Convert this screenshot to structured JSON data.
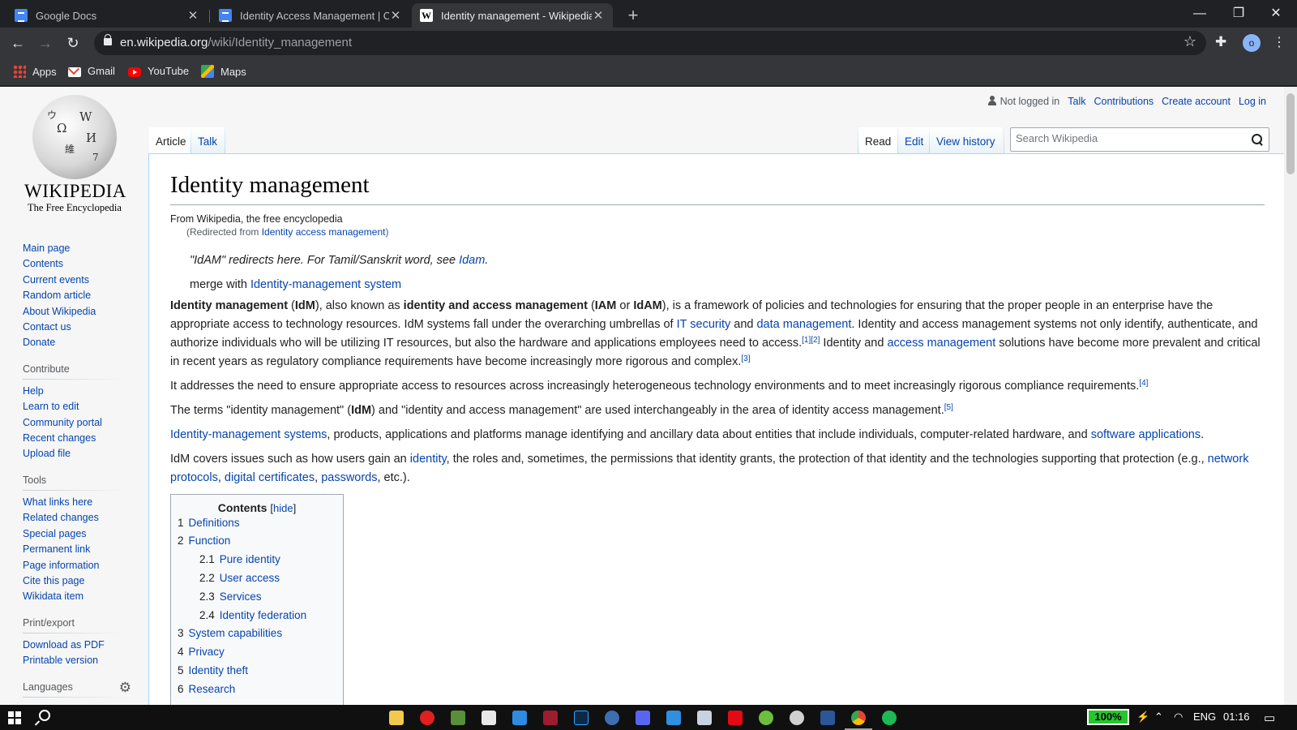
{
  "browser": {
    "tabs": [
      {
        "title": "Google Docs",
        "favicon": "docs-icon",
        "active": false
      },
      {
        "title": "Identity Access Management | Ch",
        "favicon": "docs-icon",
        "active": false
      },
      {
        "title": "Identity management - Wikipedia",
        "favicon": "wikipedia-icon",
        "active": true
      }
    ],
    "new_tab": "+",
    "url_host": "en.wikipedia.org",
    "url_path": "/wiki/Identity_management",
    "profile_initial": "o",
    "bookmarks": [
      {
        "label": "Apps",
        "icon": "apps-grid-icon"
      },
      {
        "label": "Gmail",
        "icon": "gmail-icon"
      },
      {
        "label": "YouTube",
        "icon": "youtube-icon"
      },
      {
        "label": "Maps",
        "icon": "maps-icon"
      }
    ]
  },
  "wiki": {
    "logo": {
      "wordmark": "WIKIPEDIA",
      "tagline": "The Free Encyclopedia"
    },
    "personal": {
      "not_logged_in": "Not logged in",
      "talk": "Talk",
      "contributions": "Contributions",
      "create_account": "Create account",
      "log_in": "Log in"
    },
    "tabs": {
      "article": "Article",
      "talk": "Talk",
      "read": "Read",
      "edit": "Edit",
      "history": "View history"
    },
    "search_placeholder": "Search Wikipedia",
    "sidebar": {
      "main": [
        "Main page",
        "Contents",
        "Current events",
        "Random article",
        "About Wikipedia",
        "Contact us",
        "Donate"
      ],
      "contribute": {
        "heading": "Contribute",
        "items": [
          "Help",
          "Learn to edit",
          "Community portal",
          "Recent changes",
          "Upload file"
        ]
      },
      "tools": {
        "heading": "Tools",
        "items": [
          "What links here",
          "Related changes",
          "Special pages",
          "Permanent link",
          "Page information",
          "Cite this page",
          "Wikidata item"
        ]
      },
      "print": {
        "heading": "Print/export",
        "items": [
          "Download as PDF",
          "Printable version"
        ]
      },
      "languages": {
        "heading": "Languages"
      }
    },
    "article": {
      "title": "Identity management",
      "site_sub": "From Wikipedia, the free encyclopedia",
      "redirect_prefix": "(Redirected from ",
      "redirect_link": "Identity access management",
      "redirect_suffix": ")",
      "hatnote_text": "\"IdAM\" redirects here. For Tamil/Sanskrit word, see ",
      "hatnote_link": "Idam",
      "hatnote_end": ".",
      "merge_text": "merge with ",
      "merge_link": "Identity-management system",
      "p1": {
        "b1": "Identity management",
        "t1": " (",
        "b2": "IdM",
        "t2": "), also known as ",
        "b3": "identity and access management",
        "t3": " (",
        "b4": "IAM",
        "t4": " or ",
        "b5": "IdAM",
        "t5": "), is a framework of policies and technologies for ensuring that the proper people in an enterprise have the appropriate access to technology resources. IdM systems fall under the overarching umbrellas of ",
        "l1": "IT security",
        "t6": " and ",
        "l2": "data management",
        "t7": ". Identity and access management systems not only identify, authenticate, and authorize individuals who will be utilizing IT resources, but also the hardware and applications employees need to access.",
        "ref1": "[1][2]",
        "t8": " Identity and ",
        "l3": "access management",
        "t9": " solutions have become more prevalent and critical in recent years as regulatory compliance requirements have become increasingly more rigorous and complex.",
        "ref2": "[3]"
      },
      "p2": {
        "t1": "It addresses the need to ensure appropriate access to resources across increasingly heterogeneous technology environments and to meet increasingly rigorous compliance requirements.",
        "ref": "[4]"
      },
      "p3": {
        "t1": "The terms \"identity management\" (",
        "b1": "IdM",
        "t2": ") and \"identity and access management\" are used interchangeably in the area of identity access management.",
        "ref": "[5]"
      },
      "p4": {
        "l1": "Identity-management systems",
        "t1": ", products, applications and platforms manage identifying and ancillary data about entities that include individuals, computer-related hardware, and ",
        "l2": "software applications",
        "t2": "."
      },
      "p5": {
        "t1": "IdM covers issues such as how users gain an ",
        "l1": "identity",
        "t2": ", the roles and, sometimes, the permissions that identity grants, the protection of that identity and the technologies supporting that protection (e.g., ",
        "l2": "network protocols",
        "t3": ", ",
        "l3": "digital certificates",
        "t4": ", ",
        "l4": "passwords",
        "t5": ", etc.)."
      },
      "toc": {
        "title": "Contents",
        "hide_open": "[",
        "hide": "hide",
        "hide_close": "]",
        "items": [
          {
            "num": "1",
            "label": "Definitions"
          },
          {
            "num": "2",
            "label": "Function"
          },
          {
            "num": "2.1",
            "label": "Pure identity"
          },
          {
            "num": "2.2",
            "label": "User access"
          },
          {
            "num": "2.3",
            "label": "Services"
          },
          {
            "num": "2.4",
            "label": "Identity federation"
          },
          {
            "num": "3",
            "label": "System capabilities"
          },
          {
            "num": "4",
            "label": "Privacy"
          },
          {
            "num": "5",
            "label": "Identity theft"
          },
          {
            "num": "6",
            "label": "Research"
          }
        ]
      }
    }
  },
  "taskbar": {
    "battery": "100%",
    "language": "ENG",
    "clock": "01:16"
  }
}
